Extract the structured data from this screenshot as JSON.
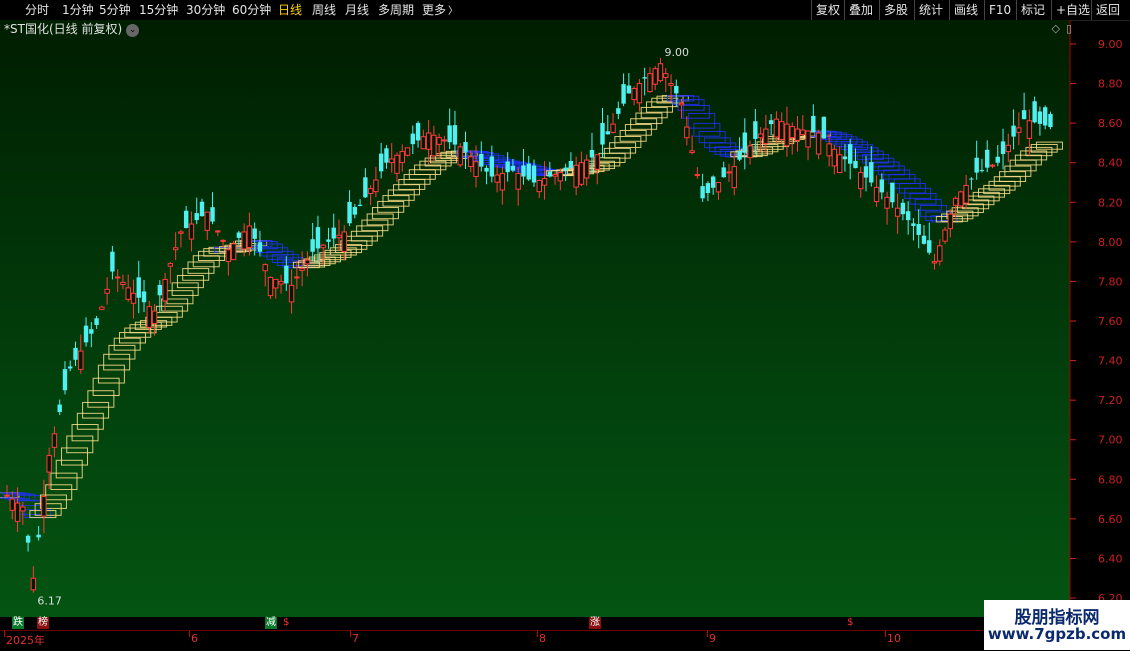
{
  "toolbar": {
    "periods": [
      "分时",
      "1分钟",
      "5分钟",
      "15分钟",
      "30分钟",
      "60分钟",
      "日线",
      "周线",
      "月线",
      "多周期",
      "更多"
    ],
    "active_period": "日线",
    "more_arrow": "〉",
    "right_buttons": [
      "复权",
      "叠加",
      "多股",
      "统计",
      "画线",
      "F10",
      "标记",
      "+自选",
      "返回"
    ]
  },
  "title": {
    "text": "*ST国化(日线 前复权)",
    "dropdown_glyph": "⌄"
  },
  "corner_icons": {
    "diamond": "◇",
    "window": "▯"
  },
  "price_labels": {
    "high": "9.00",
    "low": "6.17"
  },
  "x_axis": {
    "ticks": [
      {
        "label": "2025年",
        "x": 4
      },
      {
        "label": "6",
        "x": 189
      },
      {
        "label": "7",
        "x": 350
      },
      {
        "label": "8",
        "x": 537
      },
      {
        "label": "9",
        "x": 707
      },
      {
        "label": "10",
        "x": 885
      }
    ]
  },
  "markers": [
    {
      "text": "跌",
      "style": "green"
    },
    {
      "text": "榜",
      "style": "red"
    },
    {
      "text": "减",
      "style": "green"
    },
    {
      "text": "$",
      "style": "plain"
    },
    {
      "text": "涨",
      "style": "red"
    },
    {
      "text": "$",
      "style": "plain"
    }
  ],
  "watermark": {
    "title": "股朋指标网",
    "url": "www.7gpzb.com"
  },
  "colors": {
    "up": "#ff3b3b",
    "down": "#4ff0f0",
    "overlay_up": "#ffe08a",
    "overlay_down": "#2030ff",
    "axis": "#cc2020",
    "accent": "#ffd400"
  },
  "chart_data": {
    "type": "candlestick",
    "y_axis_ticks": [
      "6.20",
      "6.40",
      "6.60",
      "6.80",
      "7.00",
      "7.20",
      "7.40",
      "7.60",
      "7.80",
      "8.00",
      "8.20",
      "8.40",
      "8.60",
      "8.80",
      "9.00"
    ],
    "ylim": [
      6.18,
      9.02
    ],
    "anchors": [
      [
        0,
        6.72
      ],
      [
        3,
        6.66
      ],
      [
        5,
        6.3
      ],
      [
        8,
        6.92
      ],
      [
        12,
        7.36
      ],
      [
        17,
        7.58
      ],
      [
        20,
        7.85
      ],
      [
        24,
        7.74
      ],
      [
        28,
        7.65
      ],
      [
        33,
        8.05
      ],
      [
        38,
        8.15
      ],
      [
        42,
        7.96
      ],
      [
        46,
        8.08
      ],
      [
        50,
        7.82
      ],
      [
        54,
        7.78
      ],
      [
        58,
        7.95
      ],
      [
        64,
        8.05
      ],
      [
        72,
        8.4
      ],
      [
        80,
        8.55
      ],
      [
        86,
        8.48
      ],
      [
        92,
        8.33
      ],
      [
        96,
        8.36
      ],
      [
        100,
        8.3
      ],
      [
        106,
        8.36
      ],
      [
        112,
        8.44
      ],
      [
        118,
        8.75
      ],
      [
        124,
        8.9
      ],
      [
        128,
        8.7
      ],
      [
        132,
        8.22
      ],
      [
        138,
        8.38
      ],
      [
        142,
        8.52
      ],
      [
        146,
        8.62
      ],
      [
        150,
        8.57
      ],
      [
        154,
        8.55
      ],
      [
        158,
        8.44
      ],
      [
        162,
        8.35
      ],
      [
        168,
        8.2
      ],
      [
        172,
        8.08
      ],
      [
        176,
        7.9
      ],
      [
        180,
        8.22
      ],
      [
        184,
        8.35
      ],
      [
        188,
        8.4
      ],
      [
        193,
        8.62
      ],
      [
        198,
        8.58
      ]
    ],
    "count": 199
  }
}
